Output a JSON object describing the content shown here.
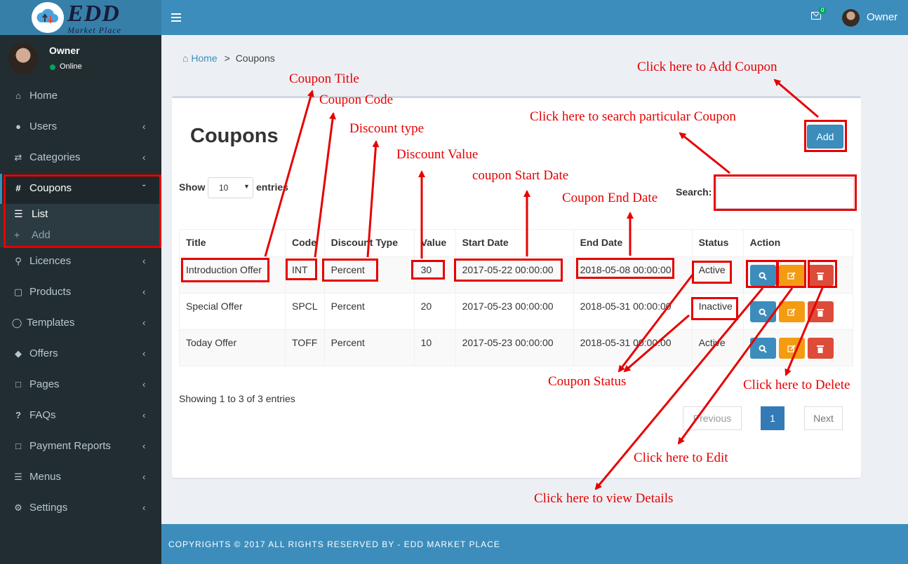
{
  "brand": {
    "name": "EDD",
    "tagline": "Market Place"
  },
  "topbar": {
    "mail_count": "0",
    "user_name": "Owner"
  },
  "sidebar": {
    "user": {
      "name": "Owner",
      "status": "Online"
    },
    "items": [
      {
        "label": "Home",
        "icon": "home-icon"
      },
      {
        "label": "Users",
        "icon": "users-icon"
      },
      {
        "label": "Categories",
        "icon": "random-icon"
      },
      {
        "label": "Coupons",
        "icon": "hashtag-icon"
      },
      {
        "label": "Licences",
        "icon": "key-icon"
      },
      {
        "label": "Products",
        "icon": "briefcase-icon"
      },
      {
        "label": "Templates",
        "icon": "comment-icon"
      },
      {
        "label": "Offers",
        "icon": "tags-icon"
      },
      {
        "label": "Pages",
        "icon": "file-icon"
      },
      {
        "label": "FAQs",
        "icon": "question-icon"
      },
      {
        "label": "Payment Reports",
        "icon": "file-icon"
      },
      {
        "label": "Menus",
        "icon": "bars-icon"
      },
      {
        "label": "Settings",
        "icon": "gear-icon"
      }
    ],
    "coupons_sub": [
      {
        "label": "List",
        "icon": "list-icon"
      },
      {
        "label": "Add",
        "icon": "plus-icon"
      }
    ]
  },
  "breadcrumb": {
    "home": "Home",
    "sep": ">",
    "current": "Coupons"
  },
  "page": {
    "title": "Coupons",
    "add_label": "Add"
  },
  "table_controls": {
    "show_label": "Show",
    "page_size": "10",
    "entries_label": "entries",
    "search_label": "Search:"
  },
  "table": {
    "headers": [
      "Title",
      "Code",
      "Discount Type",
      "Value",
      "Start Date",
      "End Date",
      "Status",
      "Action"
    ],
    "rows": [
      [
        "Introduction Offer",
        "INT",
        "Percent",
        "30",
        "2017-05-22 00:00:00",
        "2018-05-08 00:00:00",
        "Active"
      ],
      [
        "Special Offer",
        "SPCL",
        "Percent",
        "20",
        "2017-05-23 00:00:00",
        "2018-05-31 00:00:00",
        "Inactive"
      ],
      [
        "Today Offer",
        "TOFF",
        "Percent",
        "10",
        "2017-05-23 00:00:00",
        "2018-05-31 00:00:00",
        "Active"
      ]
    ]
  },
  "pagination": {
    "info": "Showing 1 to 3 of 3 entries",
    "previous": "Previous",
    "current": "1",
    "next": "Next"
  },
  "footer": {
    "text": "COPYRIGHTS © 2017 ALL RIGHTS RESERVED BY - EDD MARKET PLACE"
  },
  "annotations": {
    "coupon_title": "Coupon Title",
    "coupon_code": "Coupon Code",
    "discount_type": "Discount type",
    "discount_value": "Discount Value",
    "start_date": "coupon Start Date",
    "end_date": "Coupon End Date",
    "add_coupon": "Click here to Add Coupon",
    "search_coupon": "Click here to search particular Coupon",
    "coupon_status": "Coupon Status",
    "delete": "Click here to Delete",
    "edit": "Click here to Edit",
    "view": "Click here to view Details"
  },
  "colors": {
    "topbar": "#3c8dbc",
    "logo_bg": "#367fa9",
    "sidebar": "#222d32",
    "annotation": "#e60000",
    "btn_view": "#3c8dbc",
    "btn_edit": "#f39c12",
    "btn_delete": "#dd4b39"
  }
}
